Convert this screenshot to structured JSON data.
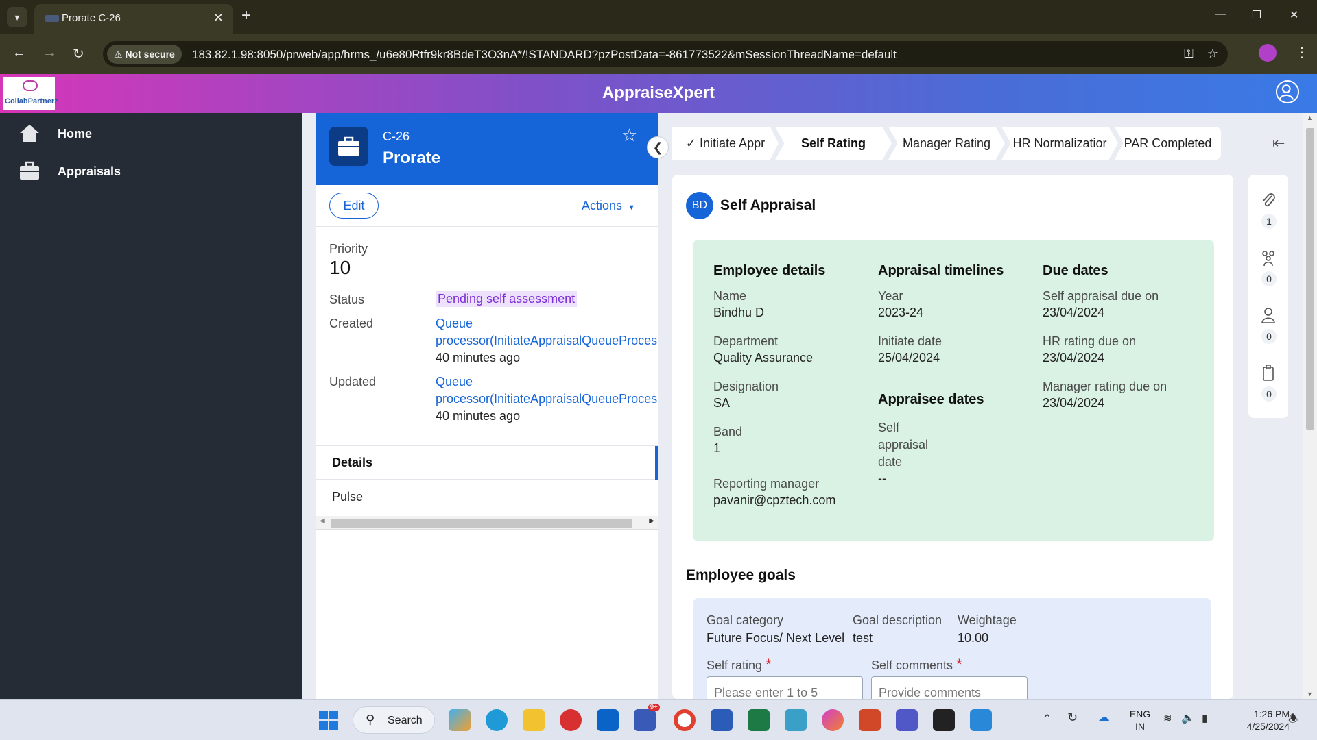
{
  "browser": {
    "tab_title": "Prorate C-26",
    "security_label": "Not secure",
    "url": "183.82.1.98:8050/prweb/app/hrms_/u6e80Rtfr9kr8BdeT3O3nA*/!STANDARD?pzPostData=-861773522&mSessionThreadName=default"
  },
  "app": {
    "title": "AppraiseXpert",
    "logo_text": "CollabPartnerz"
  },
  "nav": {
    "items": [
      {
        "label": "Home",
        "icon": "home-icon"
      },
      {
        "label": "Appraisals",
        "icon": "briefcase-icon"
      }
    ]
  },
  "case": {
    "id": "C-26",
    "name": "Prorate",
    "edit_label": "Edit",
    "actions_label": "Actions",
    "priority_label": "Priority",
    "priority_value": "10",
    "status_label": "Status",
    "status_value": "Pending self assessment",
    "created_label": "Created",
    "created_by_line1": "Queue",
    "created_by_line2": "processor(InitiateAppraisalQueueProces",
    "created_time": "40 minutes ago",
    "updated_label": "Updated",
    "updated_by_line1": "Queue",
    "updated_by_line2": "processor(InitiateAppraisalQueueProces",
    "updated_time": "40 minutes ago",
    "details_tab": "Details",
    "pulse_label": "Pulse"
  },
  "stages": [
    {
      "label": "Initiate Appr",
      "state": "completed"
    },
    {
      "label": "Self Rating",
      "state": "active"
    },
    {
      "label": "Manager Rating",
      "state": "pending"
    },
    {
      "label": "HR Normalizatior",
      "state": "pending"
    },
    {
      "label": "PAR Completed",
      "state": "pending"
    }
  ],
  "self_appraisal": {
    "avatar_initials": "BD",
    "title": "Self Appraisal",
    "employee_details": {
      "heading": "Employee details",
      "name_label": "Name",
      "name": "Bindhu D",
      "department_label": "Department",
      "department": "Quality Assurance",
      "designation_label": "Designation",
      "designation": "SA",
      "band_label": "Band",
      "band": "1",
      "manager_label": "Reporting manager",
      "manager": "pavanir@cpztech.com"
    },
    "timelines": {
      "heading": "Appraisal timelines",
      "year_label": "Year",
      "year": "2023-24",
      "initiate_label": "Initiate date",
      "initiate_date": "25/04/2024"
    },
    "appraisee_dates": {
      "heading": "Appraisee dates",
      "self_date_label_1": "Self",
      "self_date_label_2": "appraisal",
      "self_date_label_3": "date",
      "self_date_value": "--"
    },
    "due_dates": {
      "heading": "Due dates",
      "self_due_label": "Self appraisal due on",
      "self_due": "23/04/2024",
      "hr_due_label": "HR rating due on",
      "hr_due": "23/04/2024",
      "mgr_due_label": "Manager rating due on",
      "mgr_due": "23/04/2024"
    }
  },
  "goals": {
    "title": "Employee goals",
    "category_label": "Goal category",
    "category": "Future Focus/ Next Level",
    "description_label": "Goal description",
    "description": "test",
    "weightage_label": "Weightage",
    "weightage": "10.00",
    "self_rating_label": "Self rating",
    "self_rating_placeholder": "Please enter 1 to 5",
    "self_comments_label": "Self comments",
    "self_comments_placeholder": "Provide comments",
    "required_mark": "*"
  },
  "utilities": [
    {
      "icon": "paperclip-icon",
      "count": "1"
    },
    {
      "icon": "followers-icon",
      "count": "0"
    },
    {
      "icon": "user-tag-icon",
      "count": "0"
    },
    {
      "icon": "clipboard-icon",
      "count": "0"
    }
  ],
  "taskbar": {
    "search_label": "Search",
    "lang_line1": "ENG",
    "lang_line2": "IN",
    "time": "1:26 PM",
    "date": "4/25/2024",
    "outlook_badge": "9+"
  },
  "colors": {
    "primary": "#1565d8",
    "nav_bg": "#262c36",
    "info_box_bg": "#daf2e3",
    "goal_box_bg": "#e4ecfb",
    "status_badge_text": "#7a2ed6"
  }
}
